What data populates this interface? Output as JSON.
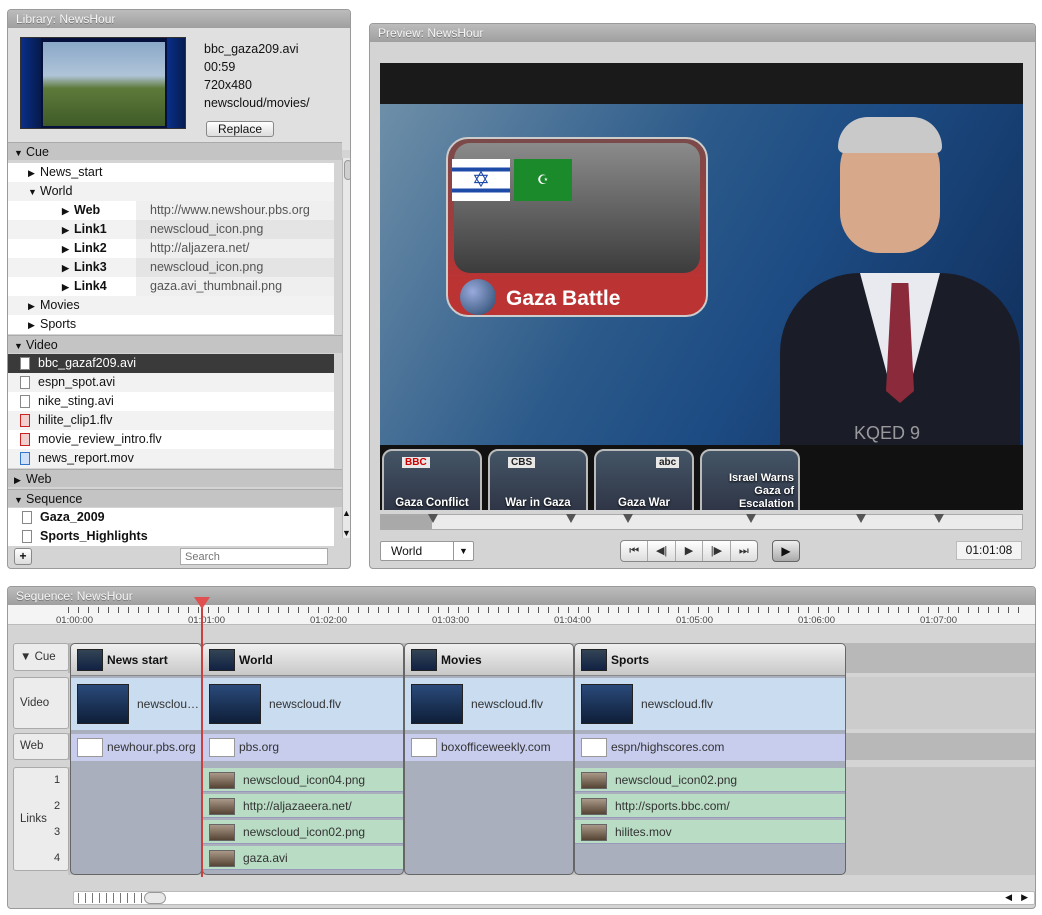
{
  "library": {
    "title": "Library: NewsHour",
    "meta": [
      "bbc_gaza209.avi",
      "00:59",
      "720x480",
      "newscloud/movies/"
    ],
    "replace_label": "Replace",
    "cue_section": "Cue",
    "cue_items": [
      {
        "label": "News_start"
      },
      {
        "label": "World"
      }
    ],
    "world_children": [
      {
        "key": "Web",
        "value": "http://www.newshour.pbs.org"
      },
      {
        "key": "Link1",
        "value": "newscloud_icon.png"
      },
      {
        "key": "Link2",
        "value": "http://aljazera.net/"
      },
      {
        "key": "Link3",
        "value": "newscloud_icon.png"
      },
      {
        "key": "Link4",
        "value": "gaza.avi_thumbnail.png"
      }
    ],
    "cue_items_after": [
      {
        "label": "Movies"
      },
      {
        "label": "Sports"
      }
    ],
    "video_section": "Video",
    "video_items": [
      "bbc_gazaf209.avi",
      "espn_spot.avi",
      "nike_sting.avi",
      "hilite_clip1.flv",
      "movie_review_intro.flv",
      "news_report.mov"
    ],
    "web_section": "Web",
    "sequence_section": "Sequence",
    "sequence_items": [
      "Gaza_2009",
      "Sports_Highlights"
    ],
    "search_placeholder": "Search",
    "add_label": "+"
  },
  "preview": {
    "title": "Preview: NewsHour",
    "graphic_caption": "Gaza Battle",
    "clips": [
      "Gaza Conflict",
      "War in Gaza",
      "Gaza War",
      "Israel Warns Gaza of Escalation"
    ],
    "clip_logos": [
      "BBC",
      "CBS",
      "abc",
      ""
    ],
    "watermark": "KQED 9",
    "select_value": "World",
    "timecode": "01:01:08",
    "playback_progress": 0.08,
    "transport": [
      "⏮",
      "◀|",
      "▶",
      "|▶",
      "⏭"
    ]
  },
  "sequence": {
    "title": "Sequence: NewsHour",
    "ruler": [
      "01:00:00",
      "01:01:00",
      "01:02:00",
      "01:03:00",
      "01:04:00",
      "01:05:00",
      "01:06:00",
      "01:07:00"
    ],
    "row_labels": {
      "cue": "Cue",
      "video": "Video",
      "web": "Web",
      "links": "Links"
    },
    "link_numbers": [
      "1",
      "2",
      "3",
      "4"
    ],
    "segments": [
      {
        "cue": "News start",
        "video": "newscloud.flv",
        "web": "newhour.pbs.org",
        "links": []
      },
      {
        "cue": "World",
        "video": "newscloud.flv",
        "web": "pbs.org",
        "links": [
          "newscloud_icon04.png",
          "http://aljazaeera.net/",
          "newscloud_icon02.png",
          "gaza.avi"
        ]
      },
      {
        "cue": "Movies",
        "video": "newscloud.flv",
        "web": "boxofficeweekly.com",
        "links": []
      },
      {
        "cue": "Sports",
        "video": "newscloud.flv",
        "web": "espn/highscores.com",
        "links": [
          "newscloud_icon02.png",
          "http://sports.bbc.com/",
          "hilites.mov"
        ]
      }
    ]
  }
}
